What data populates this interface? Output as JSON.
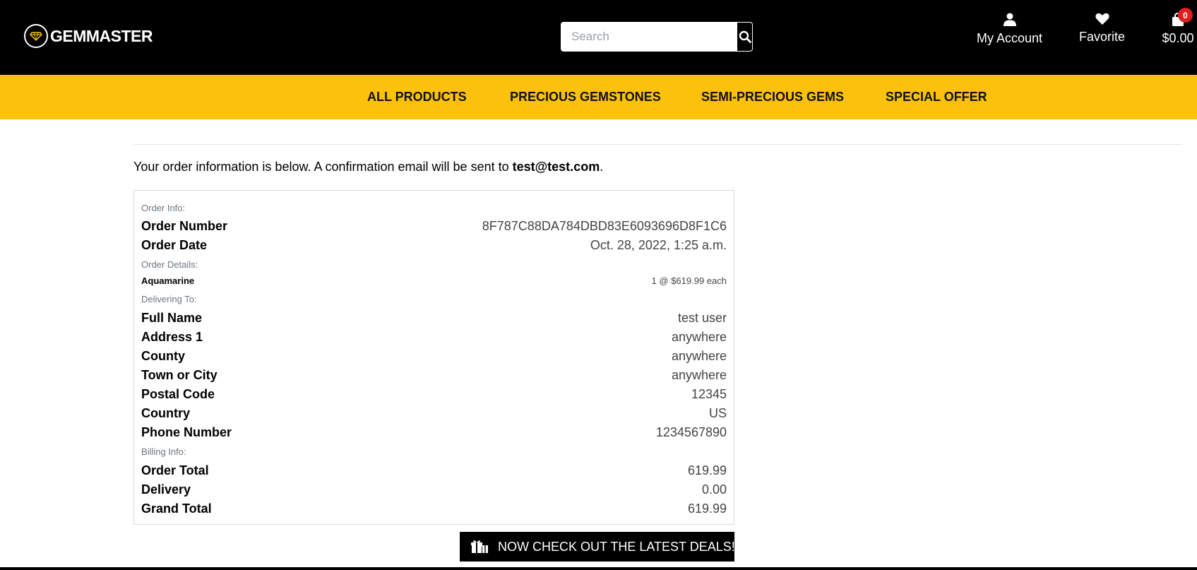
{
  "header": {
    "logo_text": "GEMMASTER",
    "search_placeholder": "Search",
    "account_label": "My Account",
    "favorite_label": "Favorite",
    "cart_count": "0",
    "cart_total": "$0.00"
  },
  "nav": {
    "items": [
      "ALL PRODUCTS",
      "PRECIOUS GEMSTONES",
      "SEMI-PRECIOUS GEMS",
      "SPECIAL OFFER"
    ]
  },
  "page": {
    "intro_prefix": "Your order information is below. A confirmation email will be sent to ",
    "intro_email": "test@test.com",
    "intro_suffix": "."
  },
  "order": {
    "info_heading": "Order Info:",
    "number_label": "Order Number",
    "number_value": "8F787C88DA784DBD83E6093696D8F1C6",
    "date_label": "Order Date",
    "date_value": "Oct. 28, 2022, 1:25 a.m.",
    "details_heading": "Order Details:",
    "item_name": "Aquamarine",
    "item_qty_price": "1 @ $619.99 each",
    "delivery_heading": "Delivering To:",
    "full_name_label": "Full Name",
    "full_name_value": "test user",
    "address1_label": "Address 1",
    "address1_value": "anywhere",
    "county_label": "County",
    "county_value": "anywhere",
    "town_label": "Town or City",
    "town_value": "anywhere",
    "postal_label": "Postal Code",
    "postal_value": "12345",
    "country_label": "Country",
    "country_value": "US",
    "phone_label": "Phone Number",
    "phone_value": "1234567890",
    "billing_heading": "Billing Info:",
    "order_total_label": "Order Total",
    "order_total_value": "619.99",
    "delivery_label": "Delivery",
    "delivery_value": "0.00",
    "grand_total_label": "Grand Total",
    "grand_total_value": "619.99"
  },
  "cta": {
    "label": "NOW CHECK OUT THE LATEST DEALS!"
  },
  "colors": {
    "header_bg": "#000000",
    "nav_bg": "#fcc10a",
    "badge": "#e01e1e"
  },
  "icons": [
    "gem-logo-icon",
    "search-icon",
    "user-icon",
    "heart-icon",
    "shopping-bag-icon",
    "gift-icon"
  ]
}
